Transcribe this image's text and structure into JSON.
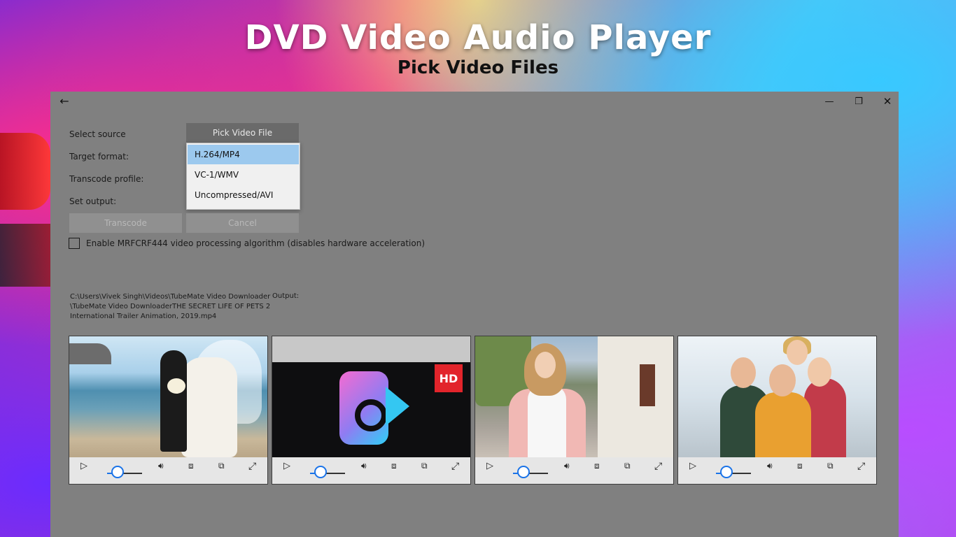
{
  "banner": {
    "title": "DVD Video Audio Player",
    "subtitle": "Pick Video Files"
  },
  "window": {
    "back_icon": "←",
    "minimize_icon": "—",
    "maximize_icon": "❐",
    "close_icon": "✕"
  },
  "form": {
    "select_source_label": "Select source",
    "target_format_label": "Target format:",
    "transcode_profile_label": "Transcode profile:",
    "set_output_label": "Set output:",
    "pick_button": "Pick Video File",
    "format_options": [
      "H.264/MP4",
      "VC-1/WMV",
      "Uncompressed/AVI"
    ],
    "selected_format": "H.264/MP4",
    "transcode_button": "Transcode",
    "cancel_button": "Cancel",
    "checkbox_label": "Enable MRFCRF444 video processing algorithm (disables hardware acceleration)",
    "checkbox_checked": false,
    "path_lines": [
      "C:\\Users\\Vivek Singh\\Videos\\TubeMate Video Downloader",
      "\\TubeMate Video DownloaderTHE SECRET LIFE OF PETS 2",
      "International Trailer Animation, 2019.mp4"
    ],
    "output_label": "Output:"
  },
  "players": [
    {
      "name": "wedding-beach",
      "volume_level": 0.3,
      "hd_badge": ""
    },
    {
      "name": "app-logo",
      "volume_level": 0.3,
      "hd_badge": "HD"
    },
    {
      "name": "woman-street",
      "volume_level": 0.3,
      "hd_badge": ""
    },
    {
      "name": "friends-selfie",
      "volume_level": 0.3,
      "hd_badge": ""
    }
  ],
  "player_icons": {
    "play": "▷",
    "volume": "🔊︎",
    "fit": "⧈",
    "cast": "⧉",
    "fullscreen": "⤢"
  },
  "colors": {
    "window_bg": "#808080",
    "accent": "#1a73e8",
    "dropdown_selected": "#9cc9ee"
  }
}
